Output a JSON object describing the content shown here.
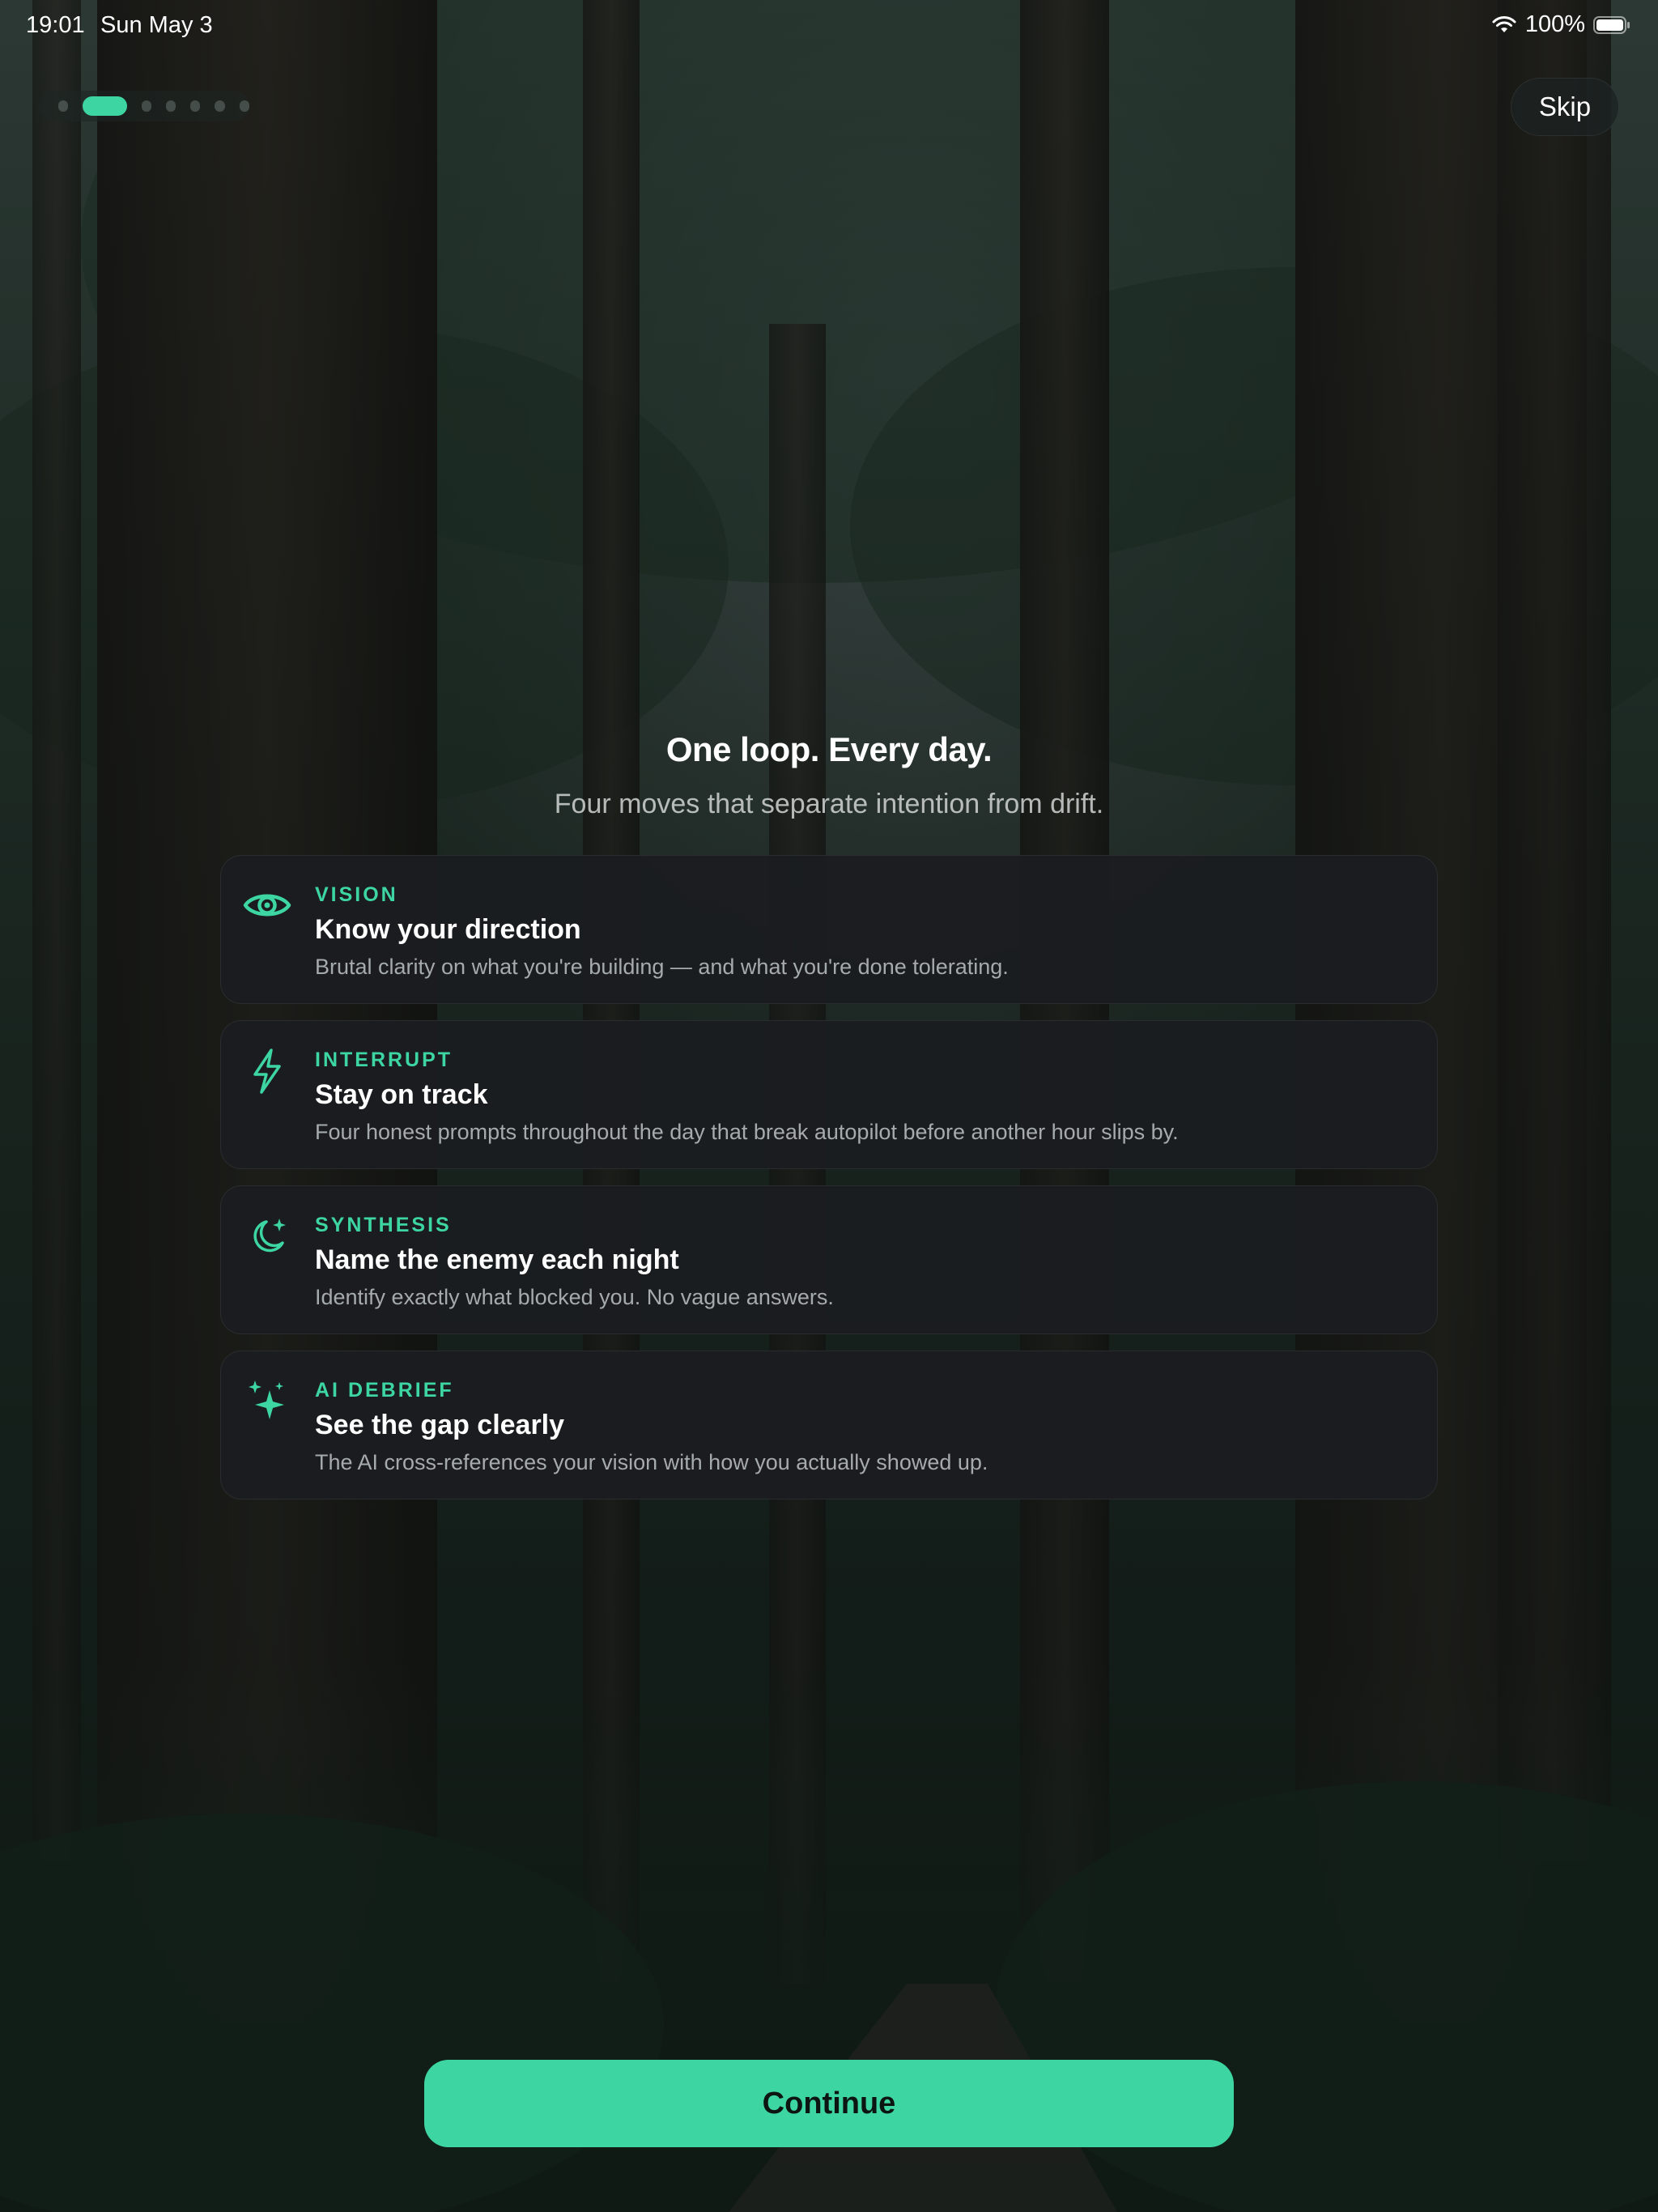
{
  "status_bar": {
    "time": "19:01",
    "date": "Sun May 3",
    "battery": "100%",
    "icons": [
      "wifi-icon",
      "battery-icon"
    ]
  },
  "onboarding": {
    "progress": {
      "total_steps": 7,
      "current_step": 2
    },
    "skip_label": "Skip",
    "title": "One loop. Every day.",
    "subtitle": "Four moves that separate intention from drift.",
    "cards": [
      {
        "icon": "eye-icon",
        "eyebrow": "VISION",
        "title": "Know your direction",
        "description": "Brutal clarity on what you're building — and what you're done tolerating."
      },
      {
        "icon": "lightning-bolt-icon",
        "eyebrow": "INTERRUPT",
        "title": "Stay on track",
        "description": "Four honest prompts throughout the day that break autopilot before another hour slips by."
      },
      {
        "icon": "moon-sparkle-icon",
        "eyebrow": "SYNTHESIS",
        "title": "Name the enemy each night",
        "description": "Identify exactly what blocked you. No vague answers."
      },
      {
        "icon": "sparkles-icon",
        "eyebrow": "AI DEBRIEF",
        "title": "See the gap clearly",
        "description": "The AI cross-references your vision with how you actually showed up."
      }
    ],
    "continue_label": "Continue"
  },
  "colors": {
    "accent": "#3dd6a3",
    "card_background": "#1b1d20",
    "text_primary": "#ffffff"
  }
}
